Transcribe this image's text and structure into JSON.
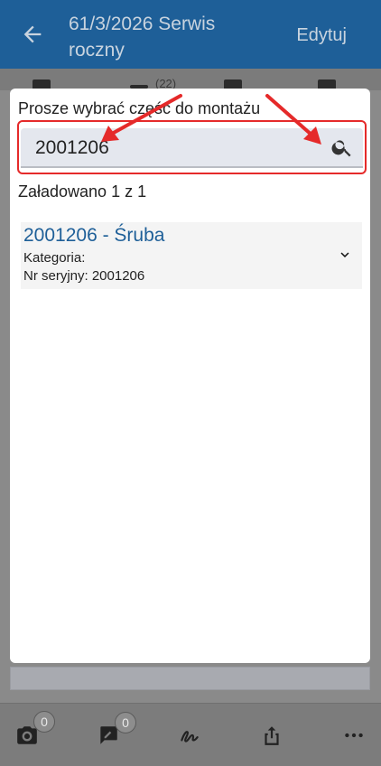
{
  "appbar": {
    "title": "61/3/2026 Serwis roczny",
    "edit_label": "Edytuj",
    "back_icon": "arrow-left-icon"
  },
  "tabs": {
    "count_badge": "(22)"
  },
  "modal": {
    "title": "Prosze wybrać część do montażu",
    "search": {
      "value": "2001206",
      "icon": "search-icon"
    },
    "loaded_text": "Załadowano 1 z 1",
    "results": [
      {
        "title": "2001206 - Śruba",
        "category_label": "Kategoria:",
        "serial_label": "Nr seryjny: 2001206"
      }
    ]
  },
  "bottombar": {
    "photo_badge": "0",
    "note_badge": "0"
  },
  "colors": {
    "primary": "#1e5f98",
    "highlight": "#e52a2a"
  }
}
